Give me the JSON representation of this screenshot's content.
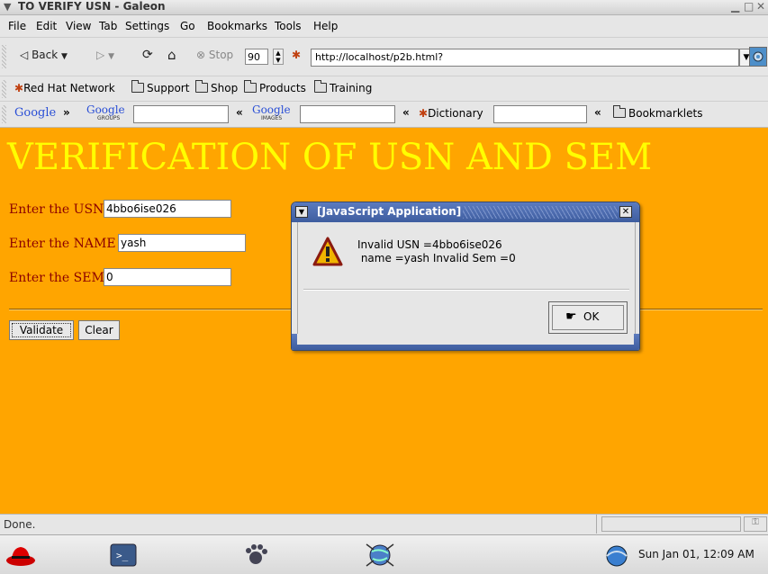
{
  "window": {
    "title": "TO VERIFY USN - Galeon"
  },
  "menu": [
    "File",
    "Edit",
    "View",
    "Tab",
    "Settings",
    "Go",
    "Bookmarks",
    "Tools",
    "Help"
  ],
  "toolbar": {
    "back_label": "Back",
    "stop_label": "Stop",
    "zoom_value": "90",
    "url": "http://localhost/p2b.html?"
  },
  "bookmarks": [
    "Red Hat Network",
    "Support",
    "Shop",
    "Products",
    "Training"
  ],
  "googlebar": {
    "google_label": "Google",
    "groups_label": "GROUPS",
    "images_label": "IMAGES",
    "raquo": "»",
    "laquo": "«",
    "dictionary_label": "Dictionary",
    "bookmarklets_label": "Bookmarklets"
  },
  "page": {
    "heading": "VERIFICATION OF USN AND SEM",
    "usn_label": "Enter the USN",
    "usn_value": "4bbo6ise026",
    "name_label": "Enter the NAME",
    "name_value": "yash",
    "sem_label": "Enter the SEM",
    "sem_value": "0",
    "validate_label": "Validate",
    "clear_label": "Clear"
  },
  "dialog": {
    "title": "[JavaScript Application]",
    "message": "Invalid USN =4bbo6ise026\n name =yash Invalid Sem =0",
    "ok_label": "OK"
  },
  "status": {
    "text": "Done."
  },
  "taskbar": {
    "clock": "Sun Jan 01, 12:09 AM"
  },
  "colors": {
    "page_bg": "#ffa500",
    "heading": "#ffff00",
    "label": "#8b0000",
    "dialog_title": "#4a69ab"
  }
}
